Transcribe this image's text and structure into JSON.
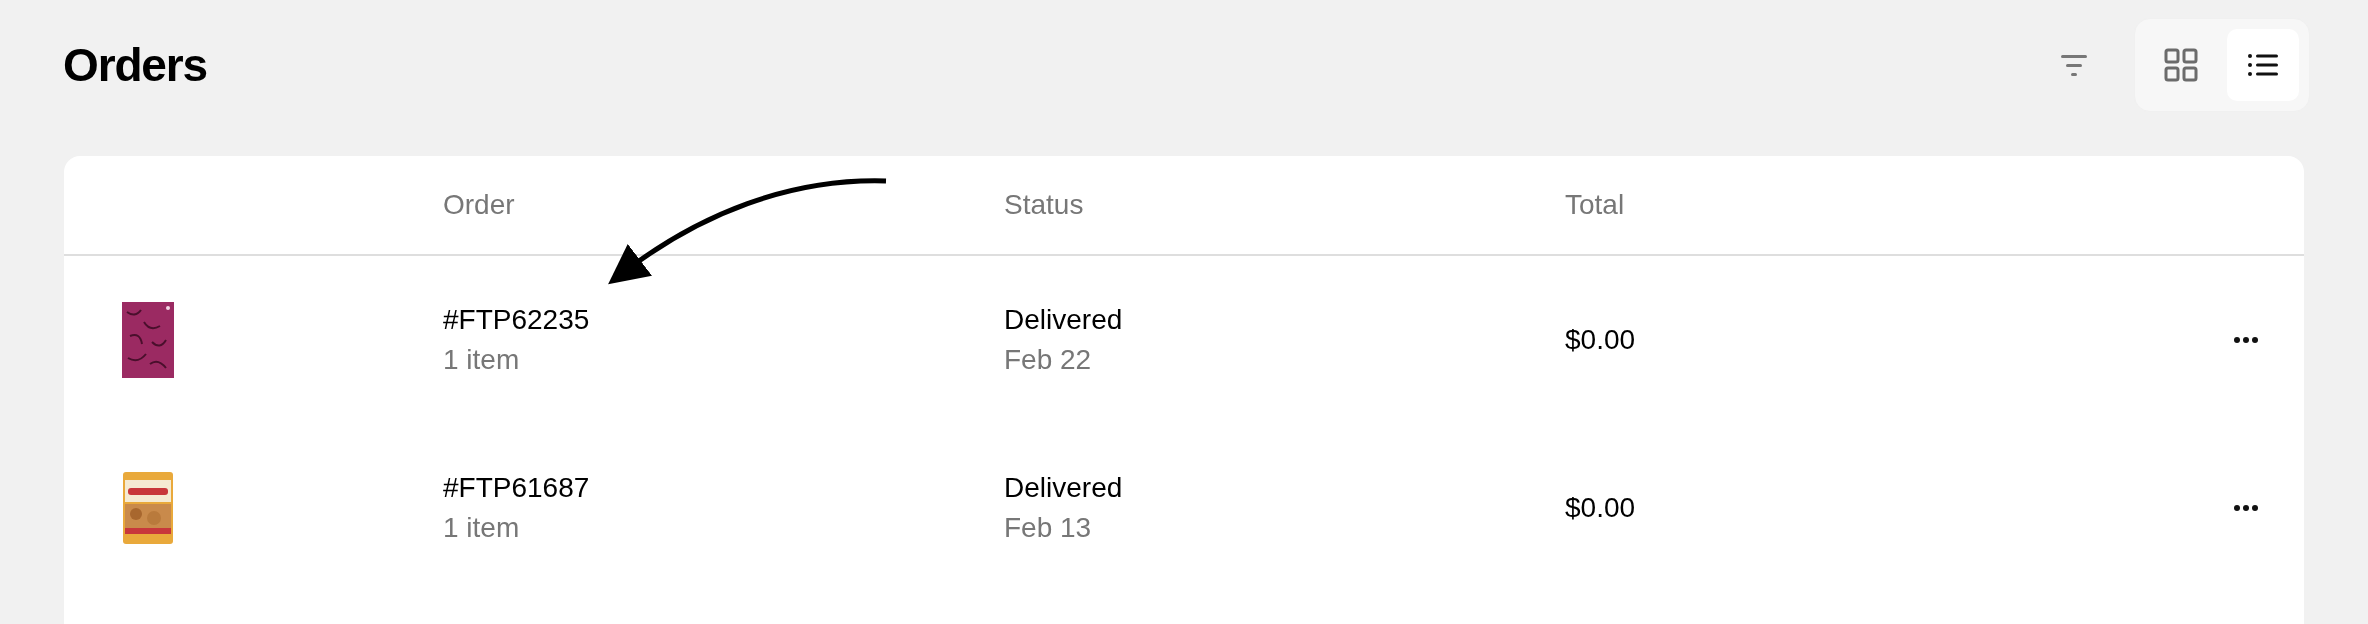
{
  "page": {
    "title": "Orders"
  },
  "toolbar": {
    "view_options": [
      {
        "kind": "grid",
        "selected": false
      },
      {
        "kind": "list",
        "selected": true
      }
    ]
  },
  "table": {
    "columns": [
      "Order",
      "Status",
      "Total"
    ],
    "rows": [
      {
        "order": "#FTP62235",
        "items": "1 item",
        "status": "Delivered",
        "date": "Feb 22",
        "total": "$0.00"
      },
      {
        "order": "#FTP61687",
        "items": "1 item",
        "status": "Delivered",
        "date": "Feb 13",
        "total": "$0.00"
      }
    ]
  }
}
